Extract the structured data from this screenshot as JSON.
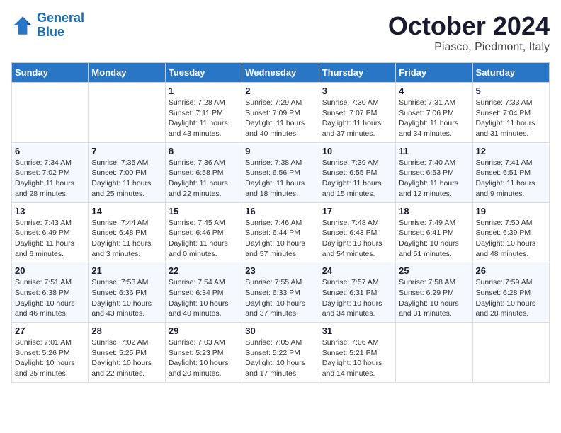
{
  "header": {
    "logo_line1": "General",
    "logo_line2": "Blue",
    "title": "October 2024",
    "subtitle": "Piasco, Piedmont, Italy"
  },
  "columns": [
    "Sunday",
    "Monday",
    "Tuesday",
    "Wednesday",
    "Thursday",
    "Friday",
    "Saturday"
  ],
  "weeks": [
    [
      {
        "day": "",
        "info": ""
      },
      {
        "day": "",
        "info": ""
      },
      {
        "day": "1",
        "info": "Sunrise: 7:28 AM\nSunset: 7:11 PM\nDaylight: 11 hours and 43 minutes."
      },
      {
        "day": "2",
        "info": "Sunrise: 7:29 AM\nSunset: 7:09 PM\nDaylight: 11 hours and 40 minutes."
      },
      {
        "day": "3",
        "info": "Sunrise: 7:30 AM\nSunset: 7:07 PM\nDaylight: 11 hours and 37 minutes."
      },
      {
        "day": "4",
        "info": "Sunrise: 7:31 AM\nSunset: 7:06 PM\nDaylight: 11 hours and 34 minutes."
      },
      {
        "day": "5",
        "info": "Sunrise: 7:33 AM\nSunset: 7:04 PM\nDaylight: 11 hours and 31 minutes."
      }
    ],
    [
      {
        "day": "6",
        "info": "Sunrise: 7:34 AM\nSunset: 7:02 PM\nDaylight: 11 hours and 28 minutes."
      },
      {
        "day": "7",
        "info": "Sunrise: 7:35 AM\nSunset: 7:00 PM\nDaylight: 11 hours and 25 minutes."
      },
      {
        "day": "8",
        "info": "Sunrise: 7:36 AM\nSunset: 6:58 PM\nDaylight: 11 hours and 22 minutes."
      },
      {
        "day": "9",
        "info": "Sunrise: 7:38 AM\nSunset: 6:56 PM\nDaylight: 11 hours and 18 minutes."
      },
      {
        "day": "10",
        "info": "Sunrise: 7:39 AM\nSunset: 6:55 PM\nDaylight: 11 hours and 15 minutes."
      },
      {
        "day": "11",
        "info": "Sunrise: 7:40 AM\nSunset: 6:53 PM\nDaylight: 11 hours and 12 minutes."
      },
      {
        "day": "12",
        "info": "Sunrise: 7:41 AM\nSunset: 6:51 PM\nDaylight: 11 hours and 9 minutes."
      }
    ],
    [
      {
        "day": "13",
        "info": "Sunrise: 7:43 AM\nSunset: 6:49 PM\nDaylight: 11 hours and 6 minutes."
      },
      {
        "day": "14",
        "info": "Sunrise: 7:44 AM\nSunset: 6:48 PM\nDaylight: 11 hours and 3 minutes."
      },
      {
        "day": "15",
        "info": "Sunrise: 7:45 AM\nSunset: 6:46 PM\nDaylight: 11 hours and 0 minutes."
      },
      {
        "day": "16",
        "info": "Sunrise: 7:46 AM\nSunset: 6:44 PM\nDaylight: 10 hours and 57 minutes."
      },
      {
        "day": "17",
        "info": "Sunrise: 7:48 AM\nSunset: 6:43 PM\nDaylight: 10 hours and 54 minutes."
      },
      {
        "day": "18",
        "info": "Sunrise: 7:49 AM\nSunset: 6:41 PM\nDaylight: 10 hours and 51 minutes."
      },
      {
        "day": "19",
        "info": "Sunrise: 7:50 AM\nSunset: 6:39 PM\nDaylight: 10 hours and 48 minutes."
      }
    ],
    [
      {
        "day": "20",
        "info": "Sunrise: 7:51 AM\nSunset: 6:38 PM\nDaylight: 10 hours and 46 minutes."
      },
      {
        "day": "21",
        "info": "Sunrise: 7:53 AM\nSunset: 6:36 PM\nDaylight: 10 hours and 43 minutes."
      },
      {
        "day": "22",
        "info": "Sunrise: 7:54 AM\nSunset: 6:34 PM\nDaylight: 10 hours and 40 minutes."
      },
      {
        "day": "23",
        "info": "Sunrise: 7:55 AM\nSunset: 6:33 PM\nDaylight: 10 hours and 37 minutes."
      },
      {
        "day": "24",
        "info": "Sunrise: 7:57 AM\nSunset: 6:31 PM\nDaylight: 10 hours and 34 minutes."
      },
      {
        "day": "25",
        "info": "Sunrise: 7:58 AM\nSunset: 6:29 PM\nDaylight: 10 hours and 31 minutes."
      },
      {
        "day": "26",
        "info": "Sunrise: 7:59 AM\nSunset: 6:28 PM\nDaylight: 10 hours and 28 minutes."
      }
    ],
    [
      {
        "day": "27",
        "info": "Sunrise: 7:01 AM\nSunset: 5:26 PM\nDaylight: 10 hours and 25 minutes."
      },
      {
        "day": "28",
        "info": "Sunrise: 7:02 AM\nSunset: 5:25 PM\nDaylight: 10 hours and 22 minutes."
      },
      {
        "day": "29",
        "info": "Sunrise: 7:03 AM\nSunset: 5:23 PM\nDaylight: 10 hours and 20 minutes."
      },
      {
        "day": "30",
        "info": "Sunrise: 7:05 AM\nSunset: 5:22 PM\nDaylight: 10 hours and 17 minutes."
      },
      {
        "day": "31",
        "info": "Sunrise: 7:06 AM\nSunset: 5:21 PM\nDaylight: 10 hours and 14 minutes."
      },
      {
        "day": "",
        "info": ""
      },
      {
        "day": "",
        "info": ""
      }
    ]
  ]
}
